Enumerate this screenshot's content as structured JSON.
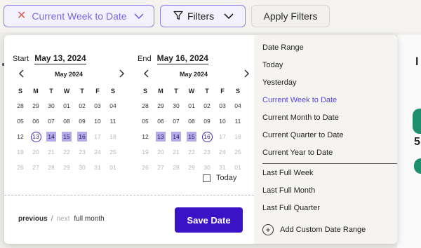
{
  "topbar": {
    "range_button_label": "Current Week to Date",
    "filters_label": "Filters",
    "apply_label": "Apply Filters"
  },
  "calendar": {
    "start": {
      "label": "Start",
      "date": "May 13, 2024",
      "month": "May 2024",
      "weekdays": [
        "S",
        "M",
        "T",
        "W",
        "T",
        "F",
        "S"
      ],
      "days": [
        {
          "d": "28"
        },
        {
          "d": "29"
        },
        {
          "d": "30"
        },
        {
          "d": "01"
        },
        {
          "d": "02"
        },
        {
          "d": "03"
        },
        {
          "d": "04"
        },
        {
          "d": "05"
        },
        {
          "d": "06"
        },
        {
          "d": "07"
        },
        {
          "d": "08"
        },
        {
          "d": "09"
        },
        {
          "d": "10"
        },
        {
          "d": "11"
        },
        {
          "d": "12"
        },
        {
          "d": "13",
          "state": "circle"
        },
        {
          "d": "14",
          "state": "sel"
        },
        {
          "d": "15",
          "state": "sel"
        },
        {
          "d": "16",
          "state": "sel"
        },
        {
          "d": "17",
          "state": "muted"
        },
        {
          "d": "18",
          "state": "muted"
        },
        {
          "d": "19",
          "state": "muted"
        },
        {
          "d": "20",
          "state": "muted"
        },
        {
          "d": "21",
          "state": "muted"
        },
        {
          "d": "22",
          "state": "muted"
        },
        {
          "d": "23",
          "state": "muted"
        },
        {
          "d": "24",
          "state": "muted"
        },
        {
          "d": "25",
          "state": "muted"
        },
        {
          "d": "26",
          "state": "muted"
        },
        {
          "d": "27",
          "state": "muted"
        },
        {
          "d": "28",
          "state": "muted"
        },
        {
          "d": "29",
          "state": "muted"
        },
        {
          "d": "30",
          "state": "muted"
        },
        {
          "d": "31",
          "state": "muted"
        },
        {
          "d": "01",
          "state": "muted"
        }
      ]
    },
    "end": {
      "label": "End",
      "date": "May 16, 2024",
      "month": "May 2024",
      "weekdays": [
        "S",
        "M",
        "T",
        "W",
        "T",
        "F",
        "S"
      ],
      "days": [
        {
          "d": "28"
        },
        {
          "d": "29"
        },
        {
          "d": "30"
        },
        {
          "d": "01"
        },
        {
          "d": "02"
        },
        {
          "d": "03"
        },
        {
          "d": "04"
        },
        {
          "d": "05"
        },
        {
          "d": "06"
        },
        {
          "d": "07"
        },
        {
          "d": "08"
        },
        {
          "d": "09"
        },
        {
          "d": "10"
        },
        {
          "d": "11"
        },
        {
          "d": "12"
        },
        {
          "d": "13",
          "state": "sel"
        },
        {
          "d": "14",
          "state": "sel"
        },
        {
          "d": "15",
          "state": "sel"
        },
        {
          "d": "16",
          "state": "circle"
        },
        {
          "d": "17",
          "state": "muted"
        },
        {
          "d": "18",
          "state": "muted"
        },
        {
          "d": "19",
          "state": "muted"
        },
        {
          "d": "20",
          "state": "muted"
        },
        {
          "d": "21",
          "state": "muted"
        },
        {
          "d": "22",
          "state": "muted"
        },
        {
          "d": "23",
          "state": "muted"
        },
        {
          "d": "24",
          "state": "muted"
        },
        {
          "d": "25",
          "state": "muted"
        },
        {
          "d": "26",
          "state": "muted"
        },
        {
          "d": "27",
          "state": "muted"
        },
        {
          "d": "28",
          "state": "muted"
        },
        {
          "d": "29",
          "state": "muted"
        },
        {
          "d": "30",
          "state": "muted"
        },
        {
          "d": "31",
          "state": "muted"
        },
        {
          "d": "01",
          "state": "muted"
        }
      ]
    },
    "today_label": "Today"
  },
  "footer": {
    "previous": "previous",
    "separator": "/",
    "next": "next",
    "full_month": "full month",
    "save_label": "Save Date"
  },
  "presets": {
    "items": [
      "Date Range",
      "Today",
      "Yesterday",
      "Current Week to Date",
      "Current Month to Date",
      "Current Quarter to Date",
      "Current Year to Date",
      "Last Full Week",
      "Last Full Month",
      "Last Full Quarter"
    ],
    "active_index": 3,
    "add_custom_label": "Add Custom Date Range"
  },
  "colors": {
    "accent": "#3a13c7",
    "active_text": "#5a47d6",
    "selected_fill": "#b6aae9"
  },
  "icons": {
    "clear": "close-icon",
    "chevron": "chevron-down-icon",
    "filter": "funnel-icon",
    "prev": "chevron-left-icon",
    "next": "chevron-right-icon",
    "add": "plus-circle-icon"
  }
}
